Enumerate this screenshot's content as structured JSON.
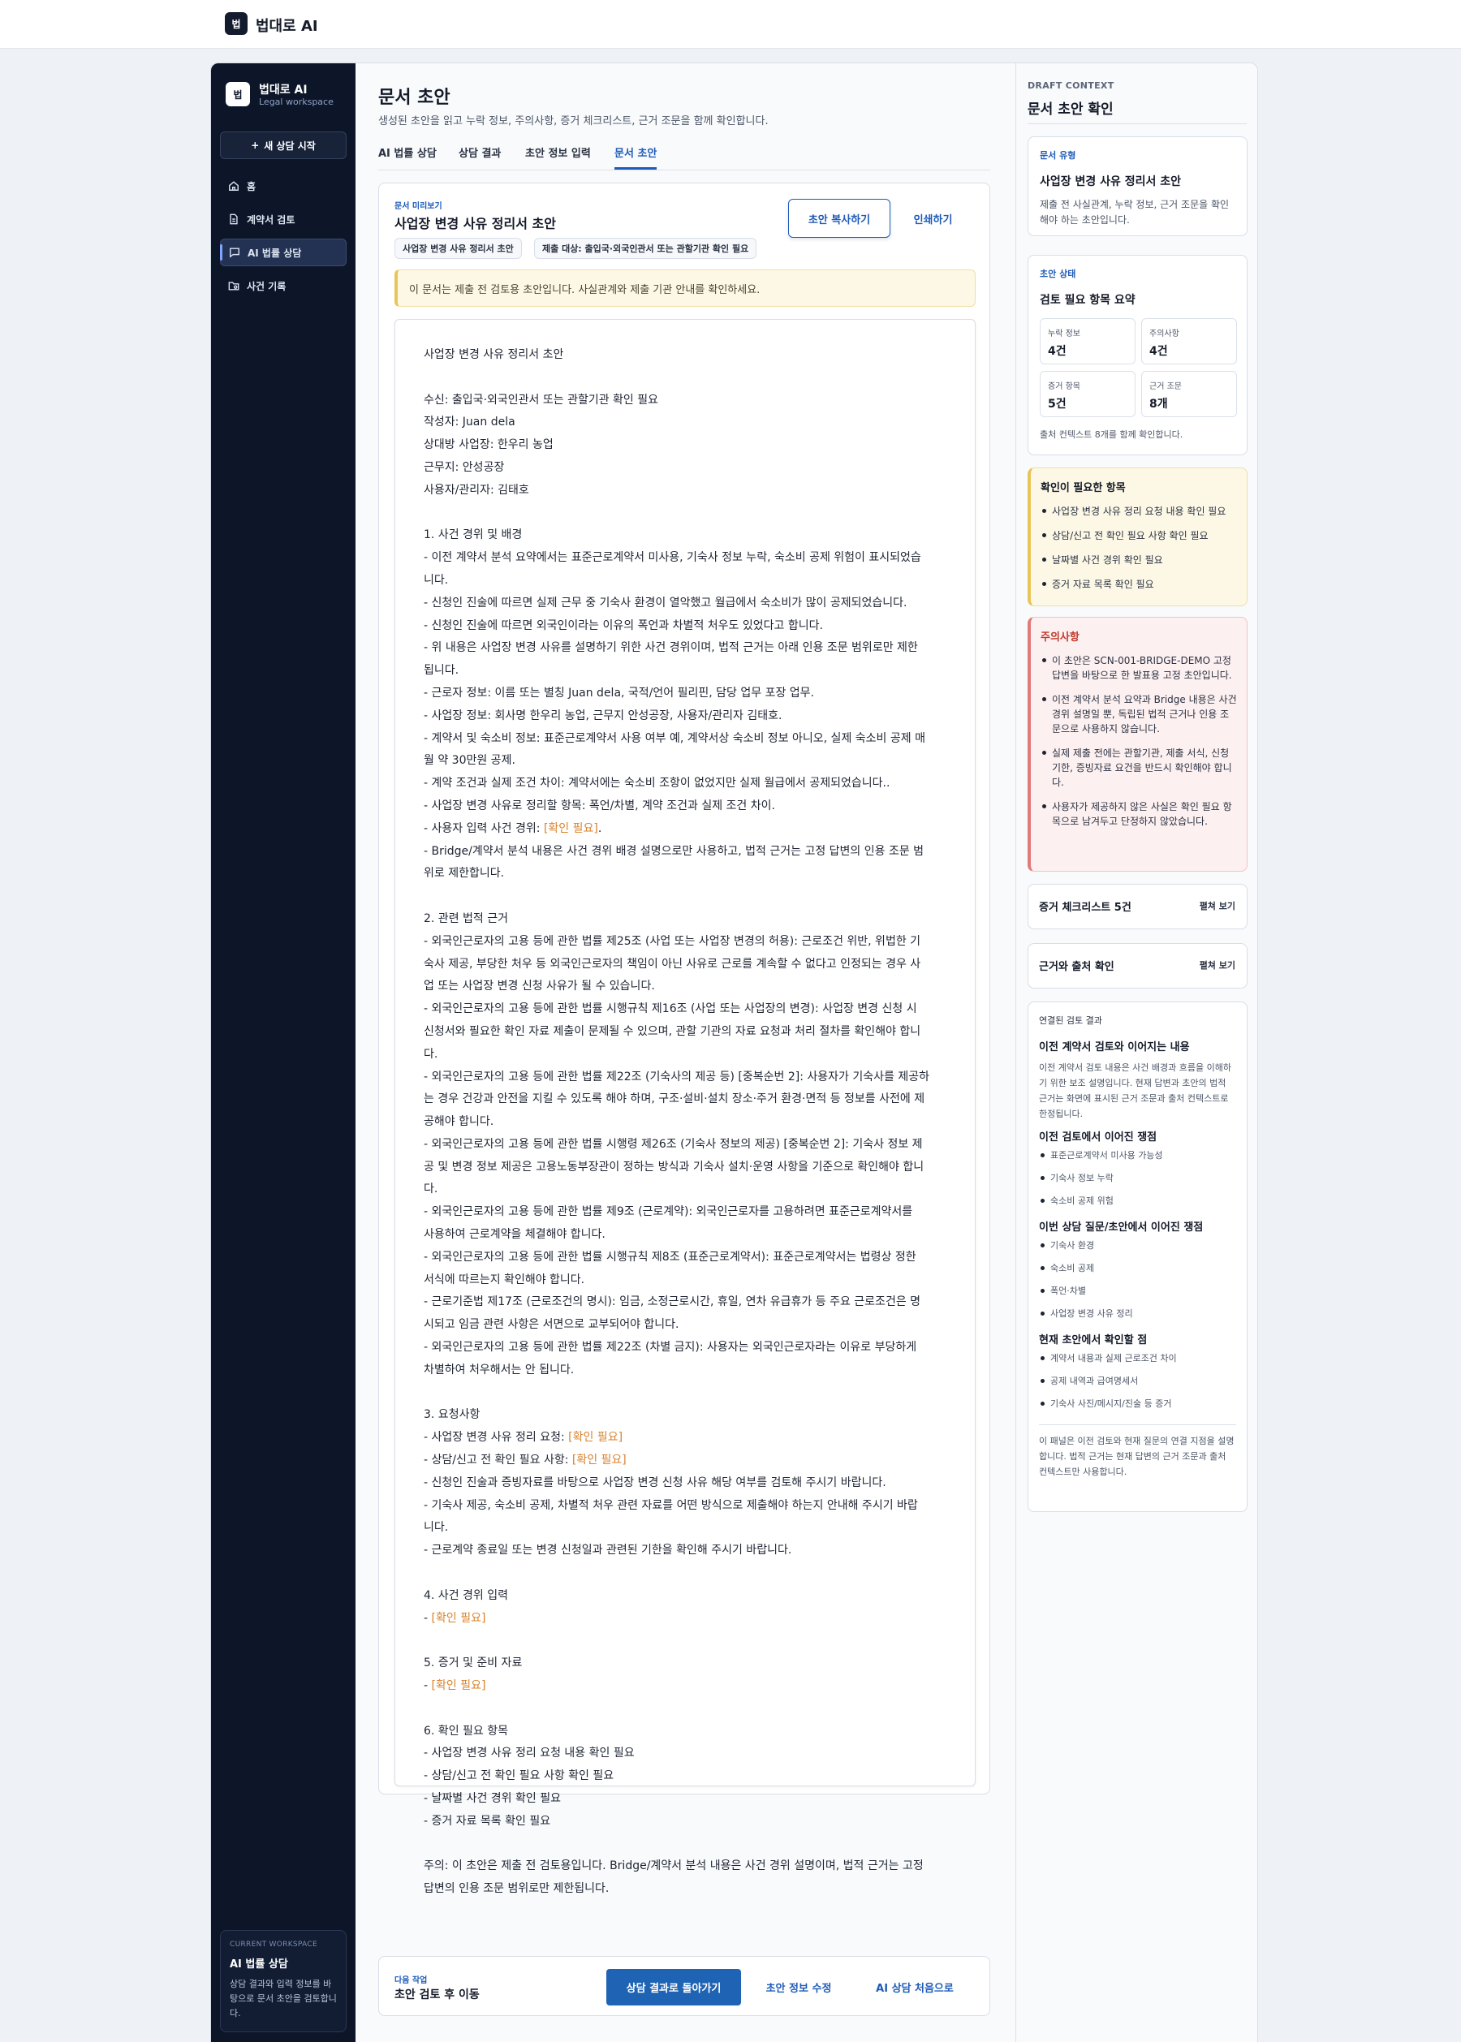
{
  "topbar": {
    "logo_glyph": "법",
    "brand": "법대로 AI"
  },
  "sidebar": {
    "logo_glyph": "법",
    "app_name": "법대로 AI",
    "app_sub": "Legal workspace",
    "new_button": "새 상담 시작",
    "items": [
      {
        "label": "홈",
        "icon": "home-icon"
      },
      {
        "label": "계약서 검토",
        "icon": "document-icon"
      },
      {
        "label": "AI 법률 상담",
        "icon": "chat-icon",
        "active": true
      },
      {
        "label": "사건 기록",
        "icon": "folder-icon"
      }
    ],
    "workspace": {
      "kicker": "CURRENT WORKSPACE",
      "title": "AI 법률 상담",
      "desc": "상담 결과와 입력 정보를 바탕으로 문서 초안을 검토합니다."
    }
  },
  "main": {
    "title": "문서 초안",
    "desc": "생성된 초안을 읽고 누락 정보, 주의사항, 증거 체크리스트, 근거 조문을 함께 확인합니다.",
    "tabs": [
      "AI 법률 상담",
      "상담 결과",
      "초안 정보 입력",
      "문서 초안"
    ],
    "active_tab": 3,
    "preview": {
      "kicker": "문서 미리보기",
      "title": "사업장 변경 사유 정리서 초안",
      "chips": [
        "사업장 변경 사유 정리서 초안",
        "제출 대상: 출입국·외국인관서 또는 관할기관 확인 필요"
      ],
      "copy_button": "초안 복사하기",
      "print_button": "인쇄하기",
      "notice": "이 문서는 제출 전 검토용 초안입니다. 사실관계와 제출 기관 안내를 확인하세요."
    },
    "document_lines": [
      "사업장 변경 사유 정리서 초안",
      "",
      "수신: 출입국·외국인관서 또는 관할기관 확인 필요",
      "작성자: Juan dela",
      "상대방 사업장: 한우리 농업",
      "근무지: 안성공장",
      "사용자/관리자: 김태호",
      "",
      "1. 사건 경위 및 배경",
      "- 이전 계약서 분석 요약에서는 표준근로계약서 미사용, 기숙사 정보 누락, 숙소비 공제 위험이 표시되었습",
      "니다.",
      "- 신청인 진술에 따르면 실제 근무 중 기숙사 환경이 열악했고 월급에서 숙소비가 많이 공제되었습니다.",
      "- 신청인 진술에 따르면 외국인이라는 이유의 폭언과 차별적 처우도 있었다고 합니다.",
      "- 위 내용은 사업장 변경 사유를 설명하기 위한 사건 경위이며, 법적 근거는 아래 인용 조문 범위로만 제한",
      "됩니다.",
      "- 근로자 정보: 이름 또는 별칭 Juan dela, 국적/언어 필리핀, 담당 업무 포장 업무.",
      "- 사업장 정보: 회사명 한우리 농업, 근무지 안성공장, 사용자/관리자 김태호.",
      "- 계약서 및 숙소비 정보: 표준근로계약서 사용 여부 예, 계약서상 숙소비 정보 아니오, 실제 숙소비 공제 매",
      "월 약 30만원 공제.",
      "- 계약 조건과 실제 조건 차이: 계약서에는 숙소비 조항이 없었지만 실제 월급에서 공제되었습니다..",
      "- 사업장 변경 사유로 정리할 항목: 폭언/차별, 계약 조건과 실제 조건 차이.",
      "- 사용자 입력 사건 경위: [[확인 필요]].",
      "- Bridge/계약서 분석 내용은 사건 경위 배경 설명으로만 사용하고, 법적 근거는 고정 답변의 인용 조문 범",
      "위로 제한합니다.",
      "",
      "2. 관련 법적 근거",
      "- 외국인근로자의 고용 등에 관한 법률 제25조 (사업 또는 사업장 변경의 허용): 근로조건 위반, 위법한 기",
      "숙사 제공, 부당한 처우 등 외국인근로자의 책임이 아닌 사유로 근로를 계속할 수 없다고 인정되는 경우 사",
      "업 또는 사업장 변경 신청 사유가 될 수 있습니다.",
      "- 외국인근로자의 고용 등에 관한 법률 시행규칙 제16조 (사업 또는 사업장의 변경): 사업장 변경 신청 시",
      "신청서와 필요한 확인 자료 제출이 문제될 수 있으며, 관할 기관의 자료 요청과 처리 절차를 확인해야 합니",
      "다.",
      "- 외국인근로자의 고용 등에 관한 법률 제22조 (기숙사의 제공 등) [중복순번 2]: 사용자가 기숙사를 제공하",
      "는 경우 건강과 안전을 지킬 수 있도록 해야 하며, 구조·설비·설치 장소·주거 환경·면적 등 정보를 사전에 제",
      "공해야 합니다.",
      "- 외국인근로자의 고용 등에 관한 법률 시행령 제26조 (기숙사 정보의 제공) [중복순번 2]: 기숙사 정보 제",
      "공 및 변경 정보 제공은 고용노동부장관이 정하는 방식과 기숙사 설치·운영 사항을 기준으로 확인해야 합니",
      "다.",
      "- 외국인근로자의 고용 등에 관한 법률 제9조 (근로계약): 외국인근로자를 고용하려면 표준근로계약서를",
      "사용하여 근로계약을 체결해야 합니다.",
      "- 외국인근로자의 고용 등에 관한 법률 시행규칙 제8조 (표준근로계약서): 표준근로계약서는 법령상 정한",
      "서식에 따르는지 확인해야 합니다.",
      "- 근로기준법 제17조 (근로조건의 명시): 임금, 소정근로시간, 휴일, 연차 유급휴가 등 주요 근로조건은 명",
      "시되고 임금 관련 사항은 서면으로 교부되어야 합니다.",
      "- 외국인근로자의 고용 등에 관한 법률 제22조 (차별 금지): 사용자는 외국인근로자라는 이유로 부당하게",
      "차별하여 처우해서는 안 됩니다.",
      "",
      "3. 요청사항",
      "- 사업장 변경 사유 정리 요청: [[확인 필요]]",
      "- 상담/신고 전 확인 필요 사항: [[확인 필요]]",
      "- 신청인 진술과 증빙자료를 바탕으로 사업장 변경 신청 사유 해당 여부를 검토해 주시기 바랍니다.",
      "- 기숙사 제공, 숙소비 공제, 차별적 처우 관련 자료를 어떤 방식으로 제출해야 하는지 안내해 주시기 바랍",
      "니다.",
      "- 근로계약 종료일 또는 변경 신청일과 관련된 기한을 확인해 주시기 바랍니다.",
      "",
      "4. 사건 경위 입력",
      "- [[확인 필요]]",
      "",
      "5. 증거 및 준비 자료",
      "- [[확인 필요]]",
      "",
      "6. 확인 필요 항목",
      "- 사업장 변경 사유 정리 요청 내용 확인 필요",
      "- 상담/신고 전 확인 필요 사항 확인 필요",
      "- 날짜별 사건 경위 확인 필요",
      "- 증거 자료 목록 확인 필요",
      "",
      "주의: 이 초안은 제출 전 검토용입니다. Bridge/계약서 분석 내용은 사건 경위 설명이며, 법적 근거는 고정",
      "답변의 인용 조문 범위로만 제한됩니다."
    ],
    "footer": {
      "kicker": "다음 작업",
      "title": "초안 검토 후 이동",
      "primary": "상담 결과로 돌아가기",
      "edit": "초안 정보 수정",
      "restart": "AI 상담 처음으로"
    }
  },
  "rail": {
    "kicker": "DRAFT CONTEXT",
    "title": "문서 초안 확인",
    "doc_type": {
      "kicker": "문서 유형",
      "title": "사업장 변경 사유 정리서 초안",
      "desc": "제출 전 사실관계, 누락 정보, 근거 조문을 확인해야 하는 초안입니다."
    },
    "status": {
      "kicker": "초안 상태",
      "title": "검토 필요 항목 요약",
      "stats": [
        {
          "label": "누락 정보",
          "value": "4건"
        },
        {
          "label": "주의사항",
          "value": "4건"
        },
        {
          "label": "증거 항목",
          "value": "5건"
        },
        {
          "label": "근거 조문",
          "value": "8개"
        }
      ],
      "note": "출처 컨텍스트 8개를 함께 확인합니다."
    },
    "check": {
      "title": "확인이 필요한 항목",
      "items": [
        "사업장 변경 사유 정리 요청 내용 확인 필요",
        "상담/신고 전 확인 필요 사항 확인 필요",
        "날짜별 사건 경위 확인 필요",
        "증거 자료 목록 확인 필요"
      ]
    },
    "caution": {
      "title": "주의사항",
      "items": [
        "이 초안은 SCN-001-BRIDGE-DEMO 고정 답변을 바탕으로 한 발표용 고정 초안입니다.",
        "이전 계약서 분석 요약과 Bridge 내용은 사건 경위 설명일 뿐, 독립된 법적 근거나 인용 조문으로 사용하지 않습니다.",
        "실제 제출 전에는 관할기관, 제출 서식, 신청 기한, 증빙자료 요건을 반드시 확인해야 합니다.",
        "사용자가 제공하지 않은 사실은 확인 필요 항목으로 남겨두고 단정하지 않았습니다."
      ]
    },
    "evidence": {
      "title": "증거 체크리스트 5건",
      "toggle": "펼쳐 보기"
    },
    "sources": {
      "title": "근거와 출처 확인",
      "toggle": "펼쳐 보기"
    },
    "linked": {
      "kicker": "연결된 검토 결과",
      "title": "이전 계약서 검토와 이어지는 내용",
      "desc": "이전 계약서 검토 내용은 사건 배경과 흐름을 이해하기 위한 보조 설명입니다. 현재 답변과 초안의 법적 근거는 화면에 표시된 근거 조문과 출처 컨텍스트로 한정됩니다.",
      "groups": [
        {
          "title": "이전 검토에서 이어진 쟁점",
          "items": [
            "표준근로계약서 미사용 가능성",
            "기숙사 정보 누락",
            "숙소비 공제 위험"
          ]
        },
        {
          "title": "이번 상담 질문/초안에서 이어진 쟁점",
          "items": [
            "기숙사 환경",
            "숙소비 공제",
            "폭언·차별",
            "사업장 변경 사유 정리"
          ]
        },
        {
          "title": "현재 초안에서 확인할 점",
          "items": [
            "계약서 내용과 실제 근로조건 차이",
            "공제 내역과 급여명세서",
            "기숙사 사진/메시지/진술 등 증거"
          ]
        }
      ],
      "footnote": "이 패널은 이전 검토와 현재 질문의 연결 지점을 설명합니다. 법적 근거는 현재 답변의 근거 조문과 출처 컨텍스트만 사용합니다."
    }
  },
  "colors": {
    "accent": "#1e5bb8",
    "sidebar": "#0d1629",
    "flag": "#d9822b",
    "warn_bg": "#fdf8e6",
    "alert_bg": "#fdf0f0"
  }
}
